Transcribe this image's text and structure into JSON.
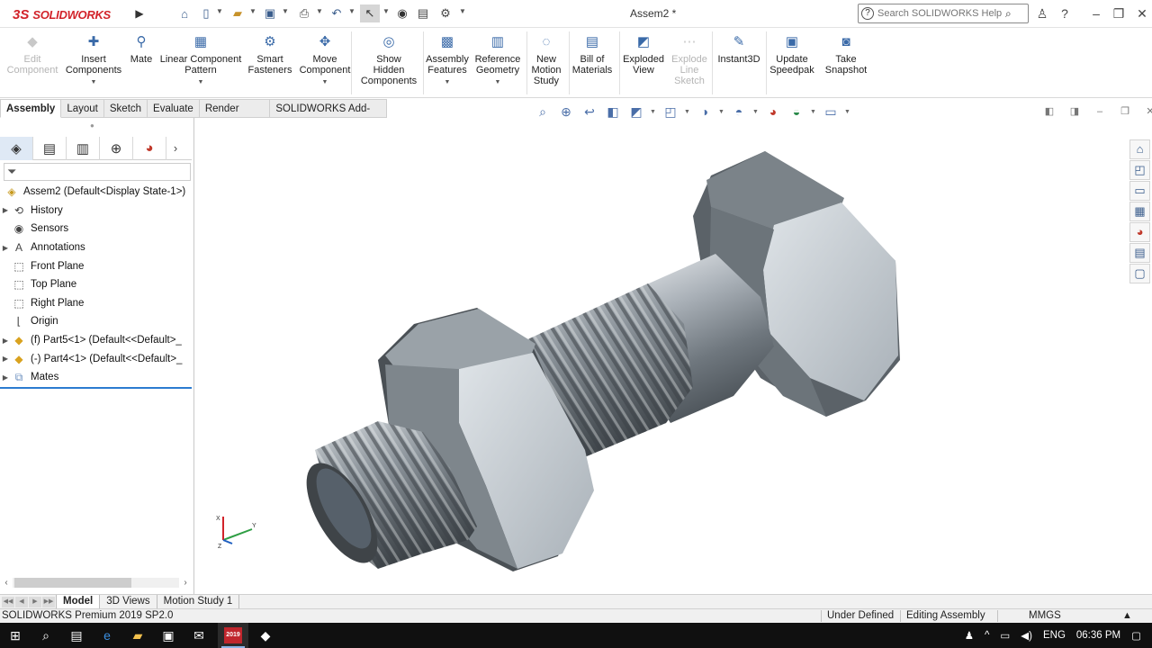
{
  "app": {
    "logo_text": "SOLIDWORKS",
    "document_title": "Assem2 *"
  },
  "search": {
    "placeholder": "Search SOLIDWORKS Help"
  },
  "ribbon": [
    {
      "label": "Edit\nComponent",
      "disabled": true
    },
    {
      "label": "Insert\nComponents",
      "dropdown": true
    },
    {
      "label": "Mate"
    },
    {
      "label": "Linear Component\nPattern",
      "dropdown": true
    },
    {
      "label": "Smart\nFasteners"
    },
    {
      "label": "Move\nComponent",
      "dropdown": true
    },
    {
      "label": "Show\nHidden\nComponents"
    },
    {
      "label": "Assembly\nFeatures",
      "dropdown": true
    },
    {
      "label": "Reference\nGeometry",
      "dropdown": true
    },
    {
      "label": "New\nMotion\nStudy"
    },
    {
      "label": "Bill of\nMaterials"
    },
    {
      "label": "Exploded\nView"
    },
    {
      "label": "Explode\nLine\nSketch",
      "disabled": true
    },
    {
      "label": "Instant3D"
    },
    {
      "label": "Update\nSpeedpak"
    },
    {
      "label": "Take\nSnapshot"
    }
  ],
  "command_tabs": [
    "Assembly",
    "Layout",
    "Sketch",
    "Evaluate",
    "Render Tools",
    "SOLIDWORKS Add-Ins"
  ],
  "tree": {
    "root": "Assem2  (Default<Display State-1>)",
    "items": [
      {
        "label": "History",
        "expandable": true,
        "icon": "history-icon"
      },
      {
        "label": "Sensors",
        "expandable": false,
        "icon": "sensor-icon"
      },
      {
        "label": "Annotations",
        "expandable": true,
        "icon": "annotation-icon"
      },
      {
        "label": "Front Plane",
        "expandable": false,
        "icon": "plane-icon"
      },
      {
        "label": "Top Plane",
        "expandable": false,
        "icon": "plane-icon"
      },
      {
        "label": "Right Plane",
        "expandable": false,
        "icon": "plane-icon"
      },
      {
        "label": "Origin",
        "expandable": false,
        "icon": "origin-icon"
      },
      {
        "label": "(f) Part5<1> (Default<<Default>_",
        "expandable": true,
        "icon": "part-icon"
      },
      {
        "label": "(-) Part4<1> (Default<<Default>_",
        "expandable": true,
        "icon": "part-icon"
      },
      {
        "label": "Mates",
        "expandable": true,
        "icon": "mates-icon"
      }
    ]
  },
  "bottom_tabs": [
    "Model",
    "3D Views",
    "Motion Study 1"
  ],
  "status": {
    "product": "SOLIDWORKS Premium 2019 SP2.0",
    "state": "Under Defined",
    "mode": "Editing Assembly",
    "units": "MMGS"
  },
  "taskbar": {
    "language": "ENG",
    "time": "06:36 PM",
    "app_badge": "2019"
  },
  "colors": {
    "brand_red": "#d2232a",
    "selection_blue": "#2c7bd0",
    "metal": "#8a9299"
  }
}
